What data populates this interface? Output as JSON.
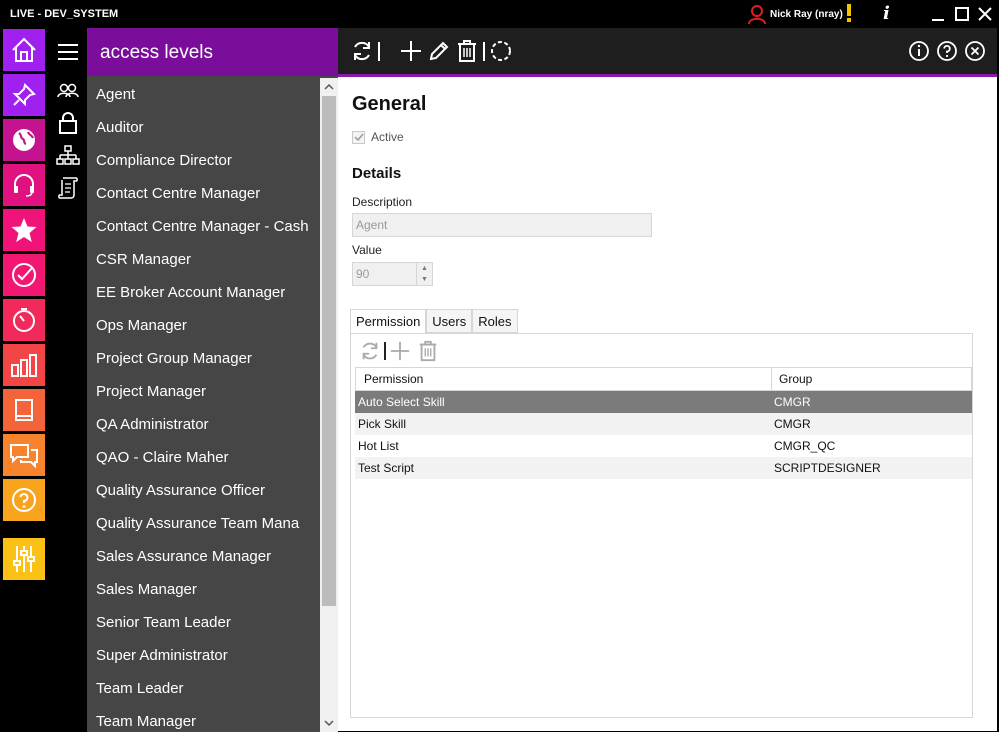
{
  "window": {
    "title": "LIVE - DEV_SYSTEM",
    "user": "Nick Ray (nray)",
    "info_glyph": "i"
  },
  "modules": [
    {
      "icon": "home-icon",
      "color": "#a020f0"
    },
    {
      "icon": "pin-icon",
      "color": "#a020f0"
    },
    {
      "icon": "globe-icon",
      "color": "#c4138f"
    },
    {
      "icon": "headset-icon",
      "color": "#e0127f"
    },
    {
      "icon": "star-icon",
      "color": "#f0147a"
    },
    {
      "icon": "check-circle-icon",
      "color": "#f11873"
    },
    {
      "icon": "timer-icon",
      "color": "#f22a5c"
    },
    {
      "icon": "bar-chart-icon",
      "color": "#f34545"
    },
    {
      "icon": "book-icon",
      "color": "#f4643a"
    },
    {
      "icon": "chat-icon",
      "color": "#f7842d"
    },
    {
      "icon": "help-icon",
      "color": "#f9a41f"
    },
    {
      "icon": "sliders-icon",
      "color": "#fbc215"
    }
  ],
  "list": {
    "header": "access levels",
    "items": [
      "Agent",
      "Auditor",
      "Compliance Director",
      "Contact Centre Manager",
      "Contact Centre Manager - Cash",
      "CSR Manager",
      "EE Broker Account Manager",
      "Ops Manager",
      "Project Group Manager",
      "Project Manager",
      "QA Administrator",
      "QAO - Claire Maher",
      "Quality Assurance Officer",
      "Quality Assurance Team Mana",
      "Sales Assurance Manager",
      "Sales Manager",
      "Senior Team Leader",
      "Super Administrator",
      "Team Leader",
      "Team Manager"
    ]
  },
  "form": {
    "section_title": "General",
    "active_label": "Active",
    "details_title": "Details",
    "description_label": "Description",
    "description_value": "Agent",
    "value_label": "Value",
    "value_value": "90"
  },
  "tabs": [
    "Permission",
    "Users",
    "Roles"
  ],
  "grid": {
    "headers": [
      "Permission",
      "Group"
    ],
    "rows": [
      {
        "permission": "Auto Select Skill",
        "group": "CMGR"
      },
      {
        "permission": "Pick Skill",
        "group": "CMGR"
      },
      {
        "permission": "Hot List",
        "group": "CMGR_QC"
      },
      {
        "permission": "Test Script",
        "group": "SCRIPTDESIGNER"
      }
    ]
  }
}
